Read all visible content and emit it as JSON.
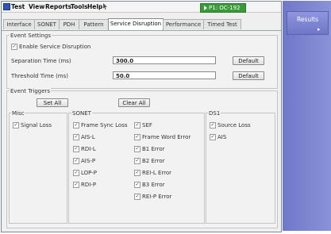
{
  "menu": {
    "items": [
      "Test",
      "View",
      "Reports",
      "Tools",
      "Help"
    ]
  },
  "port_badge": {
    "label": "P1: OC-192",
    "color": "#3a9a3a"
  },
  "tabs": [
    "Interface",
    "SONET",
    "PDH",
    "Pattern",
    "Service Disruption",
    "Performance",
    "Timed Test"
  ],
  "active_tab": "Service Disruption",
  "event_settings": {
    "title": "Event Settings",
    "enable_label": "Enable Service Disruption",
    "enable_checked": true,
    "separation_label": "Separation Time (ms)",
    "separation_value": "300.0",
    "threshold_label": "Threshold Time (ms)",
    "threshold_value": "50.0",
    "default_label": "Default"
  },
  "event_triggers": {
    "title": "Event Triggers",
    "set_all": "Set All",
    "clear_all": "Clear All",
    "misc": {
      "title": "Misc",
      "items": [
        {
          "label": "Signal Loss",
          "checked": true
        }
      ]
    },
    "sonet": {
      "title": "SONET",
      "col1": [
        {
          "label": "Frame Sync Loss",
          "checked": true
        },
        {
          "label": "AIS-L",
          "checked": true
        },
        {
          "label": "RDI-L",
          "checked": true
        },
        {
          "label": "AIS-P",
          "checked": true
        },
        {
          "label": "LOP-P",
          "checked": true
        },
        {
          "label": "RDI-P",
          "checked": true
        }
      ],
      "col2": [
        {
          "label": "SEF",
          "checked": true
        },
        {
          "label": "Frame Word Error",
          "checked": true
        },
        {
          "label": "B1 Error",
          "checked": true
        },
        {
          "label": "B2 Error",
          "checked": true
        },
        {
          "label": "REI-L Error",
          "checked": true
        },
        {
          "label": "B3 Error",
          "checked": true
        },
        {
          "label": "REI-P Error",
          "checked": true
        }
      ]
    },
    "ds1": {
      "title": "DS1",
      "items": [
        {
          "label": "Source Loss",
          "checked": true
        },
        {
          "label": "AIS",
          "checked": true
        }
      ]
    }
  },
  "results": {
    "label": "Results",
    "accent": "#7a82d0"
  },
  "check_glyph": "✓"
}
